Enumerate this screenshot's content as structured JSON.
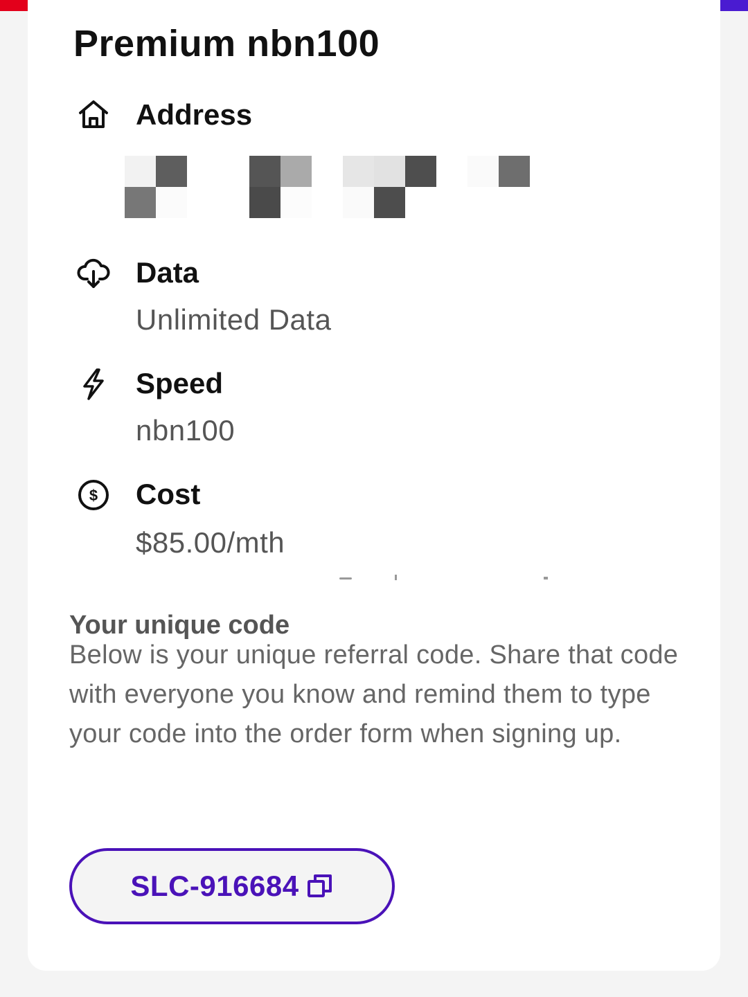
{
  "colors": {
    "accent": "#4a12b8",
    "brand_red": "#e3001b",
    "brand_purple": "#4a1bd1"
  },
  "plan": {
    "title": "Premium nbn100"
  },
  "details": [
    {
      "icon": "home-icon",
      "label": "Address",
      "value": ""
    },
    {
      "icon": "cloud-download-icon",
      "label": "Data",
      "value": "Unlimited Data"
    },
    {
      "icon": "lightning-icon",
      "label": "Speed",
      "value": "nbn100"
    },
    {
      "icon": "dollar-circle-icon",
      "label": "Cost",
      "value": "$85.00/mth"
    }
  ],
  "referral": {
    "heading": "Your unique code",
    "description": "Below is your unique referral code. Share that code with everyone you know and remind them to type your code into the order form when signing up.",
    "code": "SLC-916684",
    "copy_icon": "copy-icon"
  }
}
